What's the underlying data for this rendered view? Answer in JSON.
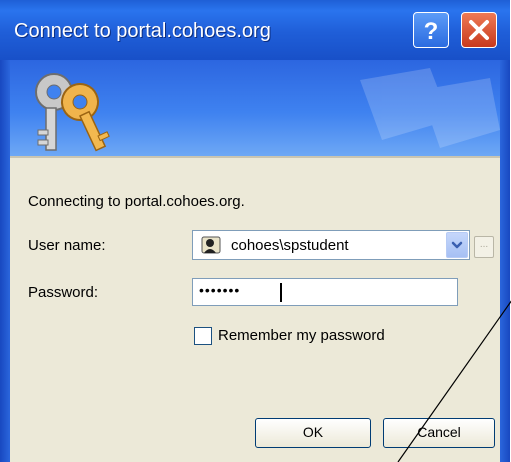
{
  "window": {
    "title": "Connect to portal.cohoes.org"
  },
  "titlebar": {
    "help_icon": "question-icon",
    "close_icon": "close-x-icon"
  },
  "banner": {
    "icon": "keys-icon"
  },
  "dialog": {
    "connecting_text": "Connecting to portal.cohoes.org.",
    "username_label": "User name:",
    "username_value": "cohoes\\spstudent",
    "password_label": "Password:",
    "password_masked": "•••••••",
    "remember_label": "Remember my password",
    "remember_checked": false,
    "browse_label": "...",
    "ok_label": "OK",
    "cancel_label": "Cancel"
  },
  "colors": {
    "titlebar": "#2a74ee",
    "dialog_bg": "#ece9d8",
    "close_btn": "#c8391e"
  }
}
